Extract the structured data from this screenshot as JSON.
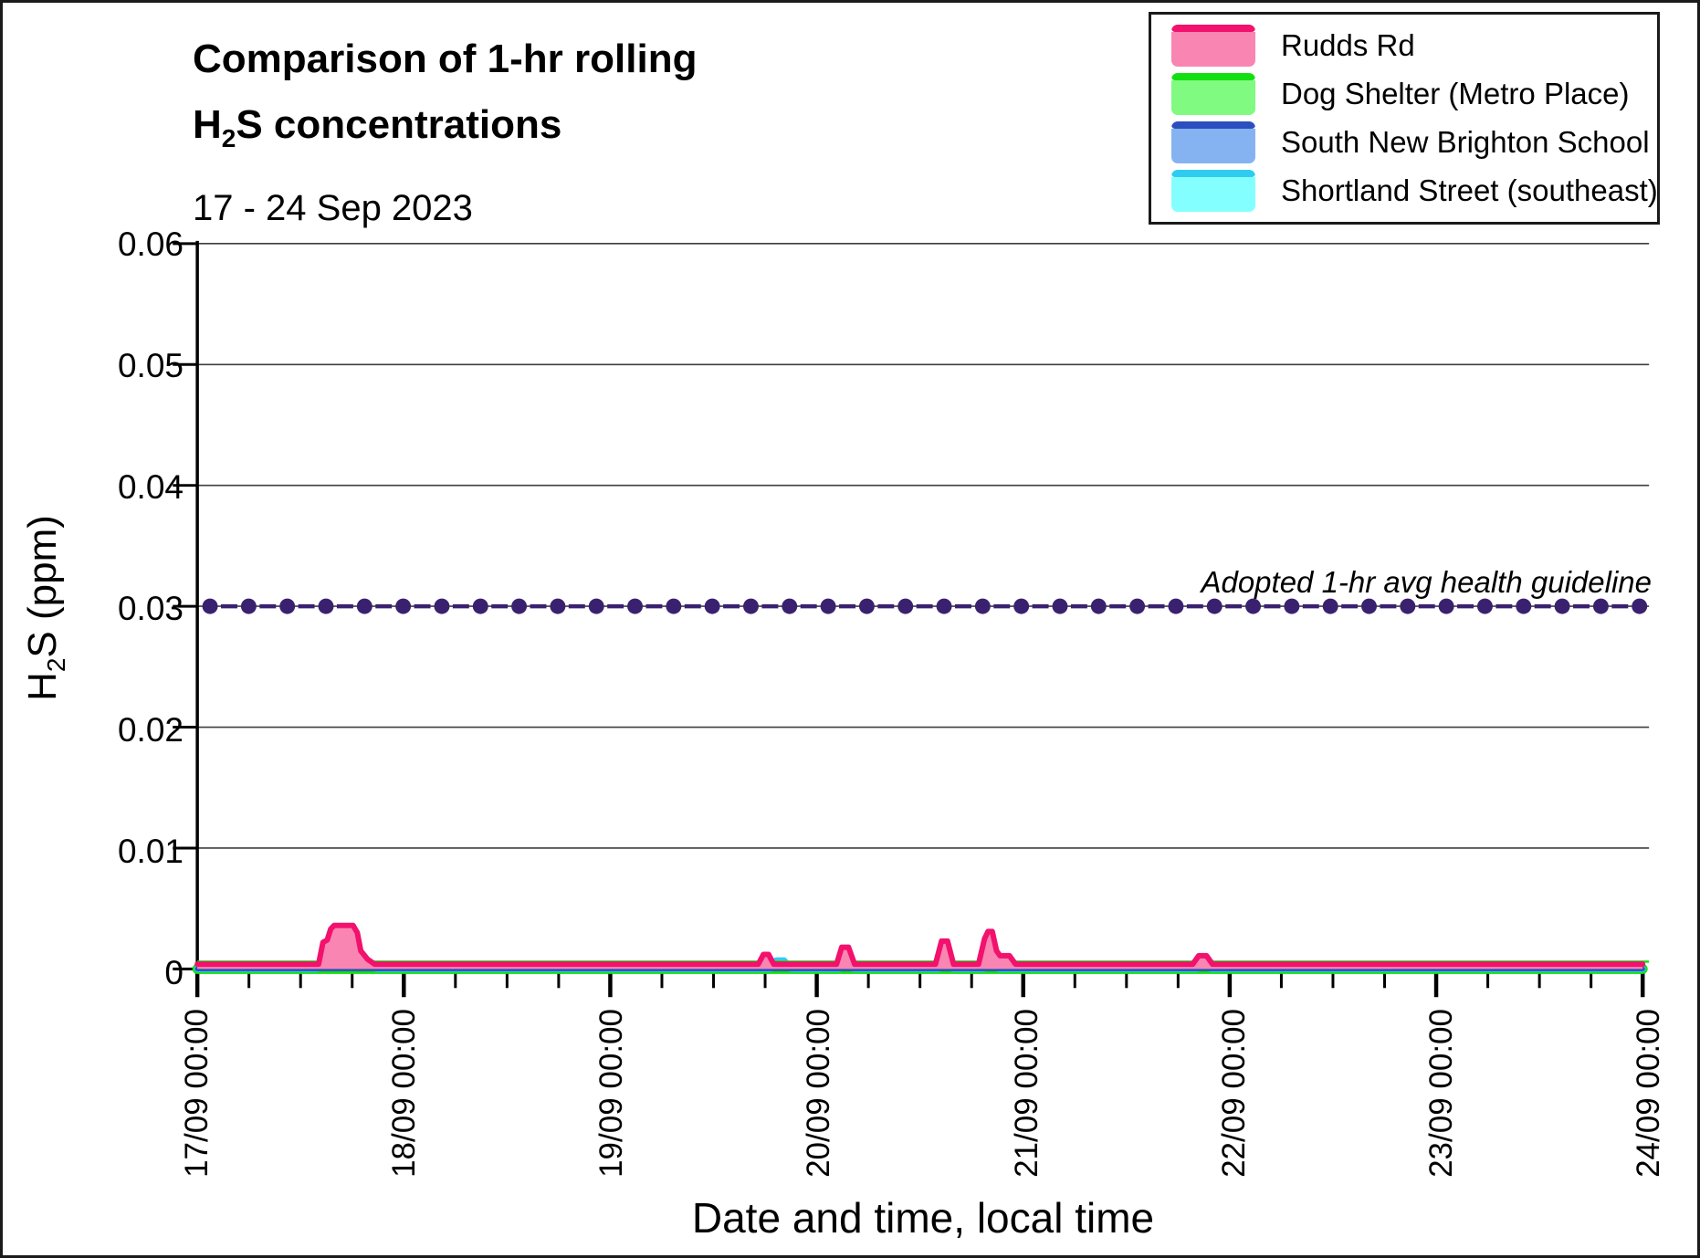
{
  "figure": {
    "title_line1": "Comparison of 1-hr rolling",
    "title_h": "H",
    "title_sub": "2",
    "title_rest": "S concentrations",
    "subtitle": "17 - 24 Sep 2023",
    "ylabel_h": "H",
    "ylabel_sub": "2",
    "ylabel_rest": "S (ppm)",
    "border_color": "#1a1a1a",
    "background": "#ffffff"
  },
  "chart_data": {
    "type": "area",
    "title": "Comparison of 1-hr rolling H2S concentrations",
    "subtitle": "17 - 24 Sep 2023",
    "xlabel": "Date and time, local time",
    "ylabel": "H2S (ppm)",
    "x_unit_hours_from": "17/09 00:00",
    "xlim_hours": [
      0,
      168
    ],
    "ylim": [
      0,
      0.06
    ],
    "grid": "horizontal-only",
    "gridline_color": "#3f3f3f",
    "y_axis": {
      "tick_values": [
        0,
        0.01,
        0.02,
        0.03,
        0.04,
        0.05,
        0.06
      ],
      "tick_labels": [
        "0",
        "0.01",
        "0.02",
        "0.03",
        "0.04",
        "0.05",
        "0.06"
      ]
    },
    "x_axis": {
      "major_tick_interval_hours": 24,
      "minor_tick_interval_hours": 6,
      "major_tick_labels": [
        "17/09 00:00",
        "18/09 00:00",
        "19/09 00:00",
        "20/09 00:00",
        "21/09 00:00",
        "22/09 00:00",
        "23/09 00:00",
        "24/09 00:00"
      ]
    },
    "guideline": {
      "value": 0.03,
      "label": "Adopted 1-hr avg health guideline",
      "color": "#3A2170",
      "style": "dashed line with circular markers over thin black gridline"
    },
    "legend_position": "top-right",
    "series": [
      {
        "name": "Rudds Rd",
        "line": "#F2116C",
        "fill": "#F985B2",
        "points_hours_ppm": [
          [
            0,
            0
          ],
          [
            14.1,
            0
          ],
          [
            14.6,
            0.0018
          ],
          [
            15.1,
            0.002
          ],
          [
            15.5,
            0.0029
          ],
          [
            15.9,
            0.0032
          ],
          [
            18.1,
            0.0032
          ],
          [
            18.6,
            0.0026
          ],
          [
            19.0,
            0.0011
          ],
          [
            19.8,
            0.0004
          ],
          [
            20.6,
            0
          ],
          [
            65.2,
            0
          ],
          [
            65.8,
            0.0008
          ],
          [
            66.4,
            0.0008
          ],
          [
            67.0,
            0
          ],
          [
            74.3,
            0
          ],
          [
            74.9,
            0.0014
          ],
          [
            75.7,
            0.0014
          ],
          [
            76.4,
            0
          ],
          [
            85.8,
            0
          ],
          [
            86.5,
            0.0019
          ],
          [
            87.2,
            0.0019
          ],
          [
            87.9,
            0
          ],
          [
            90.8,
            0
          ],
          [
            91.5,
            0.0021
          ],
          [
            91.9,
            0.0027
          ],
          [
            92.4,
            0.0027
          ],
          [
            92.9,
            0.0011
          ],
          [
            93.3,
            0.0007
          ],
          [
            94.4,
            0.0007
          ],
          [
            95.1,
            0
          ],
          [
            115.7,
            0
          ],
          [
            116.4,
            0.0007
          ],
          [
            117.3,
            0.0007
          ],
          [
            118.0,
            0
          ],
          [
            168,
            0
          ]
        ]
      },
      {
        "name": "Dog Shelter (Metro Place)",
        "line": "#12DF12",
        "fill": "#80FA80",
        "points_hours_ppm": [
          [
            0,
            0
          ],
          [
            168,
            0
          ]
        ]
      },
      {
        "name": "South New Brighton School",
        "line": "#2B4FBF",
        "fill": "#85B3F2",
        "points_hours_ppm": [
          [
            0,
            0
          ],
          [
            168,
            0
          ]
        ]
      },
      {
        "name": "Shortland Street (southeast)",
        "line": "#2FCCF2",
        "fill": "#84FFFF",
        "points_hours_ppm": [
          [
            0,
            0
          ],
          [
            13.9,
            0
          ],
          [
            14.9,
            0.0004
          ],
          [
            18.7,
            0.0004
          ],
          [
            20.9,
            0
          ],
          [
            66.6,
            0
          ],
          [
            67.3,
            0.0007
          ],
          [
            68.2,
            0.0007
          ],
          [
            69.0,
            0
          ],
          [
            74.6,
            0
          ],
          [
            75.6,
            0.0004
          ],
          [
            76.3,
            0
          ],
          [
            86.2,
            0
          ],
          [
            87.0,
            0.0004
          ],
          [
            87.8,
            0
          ],
          [
            91.4,
            0
          ],
          [
            92.2,
            0.0005
          ],
          [
            93.1,
            0
          ],
          [
            116.2,
            0
          ],
          [
            117.0,
            0.0004
          ],
          [
            117.8,
            0
          ],
          [
            168,
            0
          ]
        ]
      }
    ]
  }
}
